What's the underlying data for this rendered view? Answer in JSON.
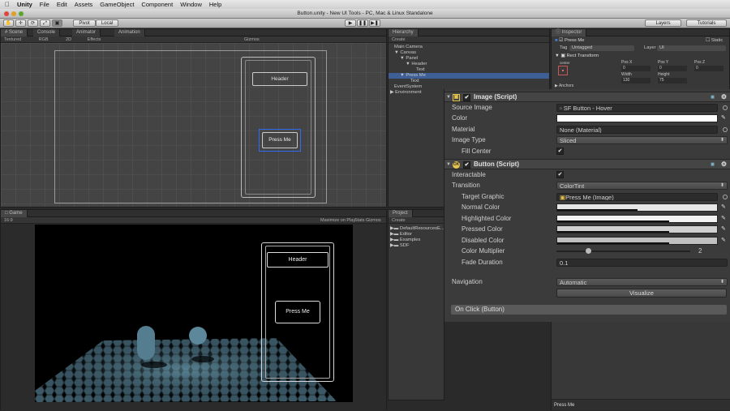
{
  "menubar": {
    "apple": "",
    "app": "Unity",
    "items": [
      "File",
      "Edit",
      "Assets",
      "GameObject",
      "Component",
      "Window",
      "Help"
    ]
  },
  "window": {
    "title": "Button.unity - New UI Tools - PC, Mac & Linux Standalone"
  },
  "toolbar": {
    "pivot": "Pivot",
    "local": "Local",
    "layers": "Layers",
    "layout": "Tutorials"
  },
  "scene": {
    "tabs": [
      "Scene",
      "Console",
      "Animator",
      "Animation"
    ],
    "sub": {
      "textured": "Textured",
      "rgb": "RGB",
      "mode2d": "2D",
      "effects": "Effects",
      "gizmos": "Gizmos"
    },
    "header_label": "Header",
    "button_label": "Press Me"
  },
  "game": {
    "tab": "Game",
    "aspect": "16:9",
    "maximize": "Maximize on Play",
    "stats": "Stats",
    "gizmos": "Gizmos",
    "header_label": "Header",
    "button_label": "Press Me"
  },
  "hierarchy": {
    "tab": "Hierarchy",
    "create": "Create",
    "items": [
      "Main Camera",
      "Canvas",
      "Panel",
      "Header",
      "Text",
      "Press Me",
      "Text",
      "EventSystem",
      "Environment"
    ]
  },
  "project": {
    "tab": "Project",
    "create": "Create",
    "items": [
      "DefaultResourcesE...",
      "Editor",
      "Examples",
      "SDF"
    ]
  },
  "inspector": {
    "tab": "Inspector",
    "object_name": "Press Me",
    "static": "Static",
    "tag_label": "Tag",
    "tag_value": "Untagged",
    "layer_label": "Layer",
    "layer_value": "UI",
    "rect_title": "Rect Transform",
    "rect_center": "center",
    "rect_fields": [
      {
        "label": "Pos X",
        "value": "0"
      },
      {
        "label": "Pos Y",
        "value": "0"
      },
      {
        "label": "Pos Z",
        "value": "0"
      },
      {
        "label": "Width",
        "value": "130"
      },
      {
        "label": "Height",
        "value": "75"
      }
    ],
    "anchors": "Anchors",
    "image": {
      "title": "Image (Script)",
      "source_label": "Source Image",
      "source_value": "SF Button - Hover",
      "color_label": "Color",
      "material_label": "Material",
      "material_value": "None (Material)",
      "type_label": "Image Type",
      "type_value": "Sliced",
      "fill_label": "Fill Center",
      "check": "✔"
    },
    "button": {
      "title": "Button (Script)",
      "interactable_label": "Interactable",
      "check": "✔",
      "transition_label": "Transition",
      "transition_value": "ColorTint",
      "target_label": "Target Graphic",
      "target_value": "Press Me (Image)",
      "normal_label": "Normal Color",
      "normal_fill": 0.5,
      "highlighted_label": "Highlighted Color",
      "highlighted_fill": 0.7,
      "pressed_label": "Pressed Color",
      "pressed_fill": 0.7,
      "disabled_label": "Disabled Color",
      "disabled_fill": 0.7,
      "multiplier_label": "Color Multiplier",
      "multiplier_value": "2",
      "multiplier_fill": 0.22,
      "fade_label": "Fade Duration",
      "fade_value": "0.1",
      "navigation_label": "Navigation",
      "navigation_value": "Automatic",
      "visualize": "Visualize",
      "onclick": "On Click (Button)"
    },
    "footer_name": "Press Me"
  },
  "colors": {
    "selection": "#3e5f96",
    "accent_blue": "#4a7bd0"
  }
}
